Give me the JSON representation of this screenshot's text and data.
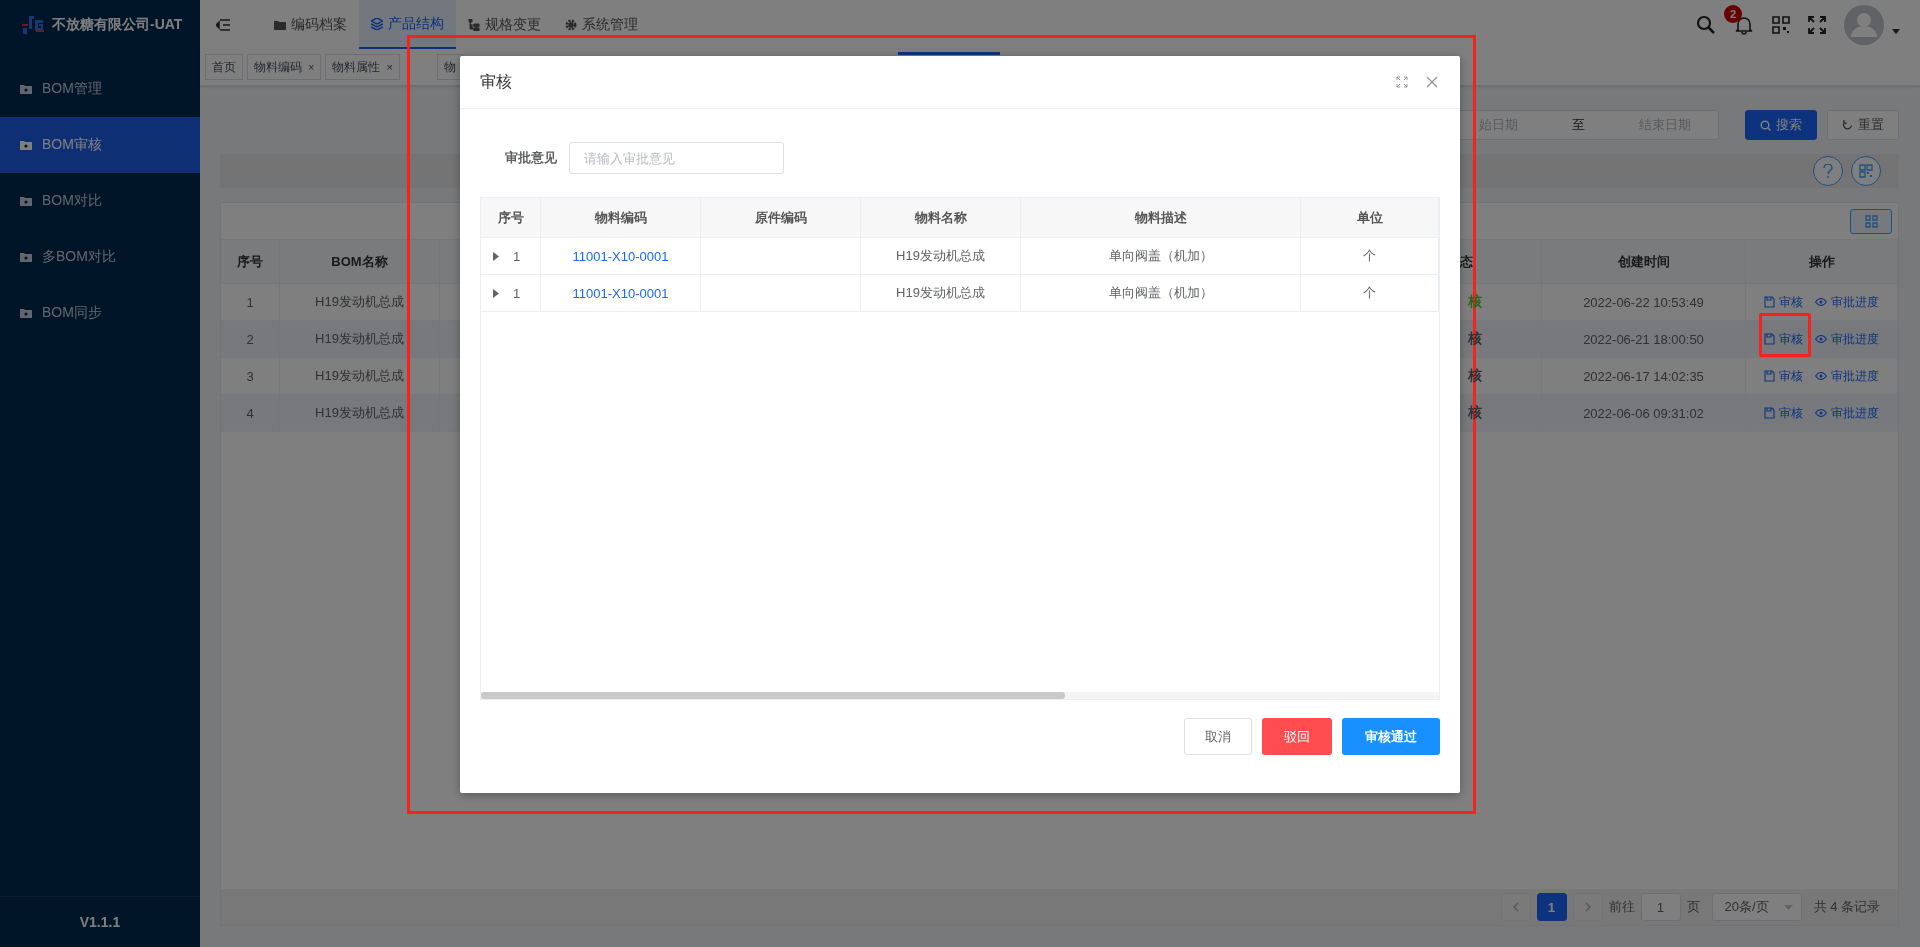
{
  "app": {
    "company": "不放糖有限公司-UAT",
    "version": "V1.1.1"
  },
  "sidebar": {
    "items": [
      {
        "label": "BOM管理",
        "selected": false
      },
      {
        "label": "BOM审核",
        "selected": true
      },
      {
        "label": "BOM对比",
        "selected": false
      },
      {
        "label": "多BOM对比",
        "selected": false
      },
      {
        "label": "BOM同步",
        "selected": false
      }
    ]
  },
  "top_nav": {
    "items": [
      {
        "label": "编码档案",
        "selected": false,
        "kind": "folder"
      },
      {
        "label": "产品结构",
        "selected": true,
        "kind": "layers"
      },
      {
        "label": "规格变更",
        "selected": false,
        "kind": "hierarchy"
      },
      {
        "label": "系统管理",
        "selected": false,
        "kind": "gear"
      }
    ],
    "notification_count": "2"
  },
  "page_tabs": [
    {
      "label": "首页"
    },
    {
      "label": "物料编码",
      "close": "×"
    },
    {
      "label": "物料属性",
      "close": "×"
    },
    {
      "label": "物"
    }
  ],
  "search": {
    "start_placeholder": "始日期",
    "separator": "至",
    "end_placeholder": "结束日期",
    "search_button": "搜索",
    "reset_button": "重置"
  },
  "bom_table": {
    "columns": [
      "序号",
      "BOM名称",
      "态",
      "创建时间",
      "操作"
    ],
    "rows": [
      {
        "index": "1",
        "name": "H19发动机总成",
        "status": {
          "text": "核",
          "color": "#33611d"
        },
        "created": "2022-06-22 10:53:49",
        "actions": [
          "审核",
          "审批进度"
        ]
      },
      {
        "index": "2",
        "name": "H19发动机总成",
        "status": {
          "text": "核",
          "color": "#303133"
        },
        "created": "2022-06-21 18:00:50",
        "actions": [
          "审核",
          "审批进度"
        ]
      },
      {
        "index": "3",
        "name": "H19发动机总成",
        "status": {
          "text": "核",
          "color": "#303133"
        },
        "created": "2022-06-17 14:02:35",
        "actions": [
          "审核",
          "审批进度"
        ]
      },
      {
        "index": "4",
        "name": "H19发动机总成",
        "status": {
          "text": "核",
          "color": "#303133"
        },
        "created": "2022-06-06 09:31:02",
        "actions": [
          "审核",
          "审批进度"
        ]
      }
    ]
  },
  "pagination": {
    "pages": [
      {
        "label": "1",
        "selected": true
      }
    ],
    "goto_label": "前往",
    "goto_value": "1",
    "page_unit": "页",
    "page_size": "20条/页",
    "total": "共 4 条记录"
  },
  "dialog": {
    "title": "审核",
    "opinion_label": "审批意见",
    "opinion_placeholder": "请输入审批意见",
    "columns": [
      "序号",
      "物料编码",
      "原件编码",
      "物料名称",
      "物料描述",
      "单位"
    ],
    "rows": [
      {
        "expanded": false,
        "index": "1",
        "code": "11001-X10-0001",
        "name": "H19发动机总成",
        "description": "单向阀盖（机加）",
        "unit": "个"
      },
      {
        "expanded": false,
        "index": "1",
        "code": "11001-X10-0001",
        "name": "H19发动机总成",
        "description": "单向阀盖（机加）",
        "unit": "个"
      }
    ],
    "buttons": [
      {
        "label": "取消",
        "kind": "default"
      },
      {
        "label": "驳回",
        "kind": "danger"
      },
      {
        "label": "审核通过",
        "kind": "primary"
      }
    ]
  }
}
